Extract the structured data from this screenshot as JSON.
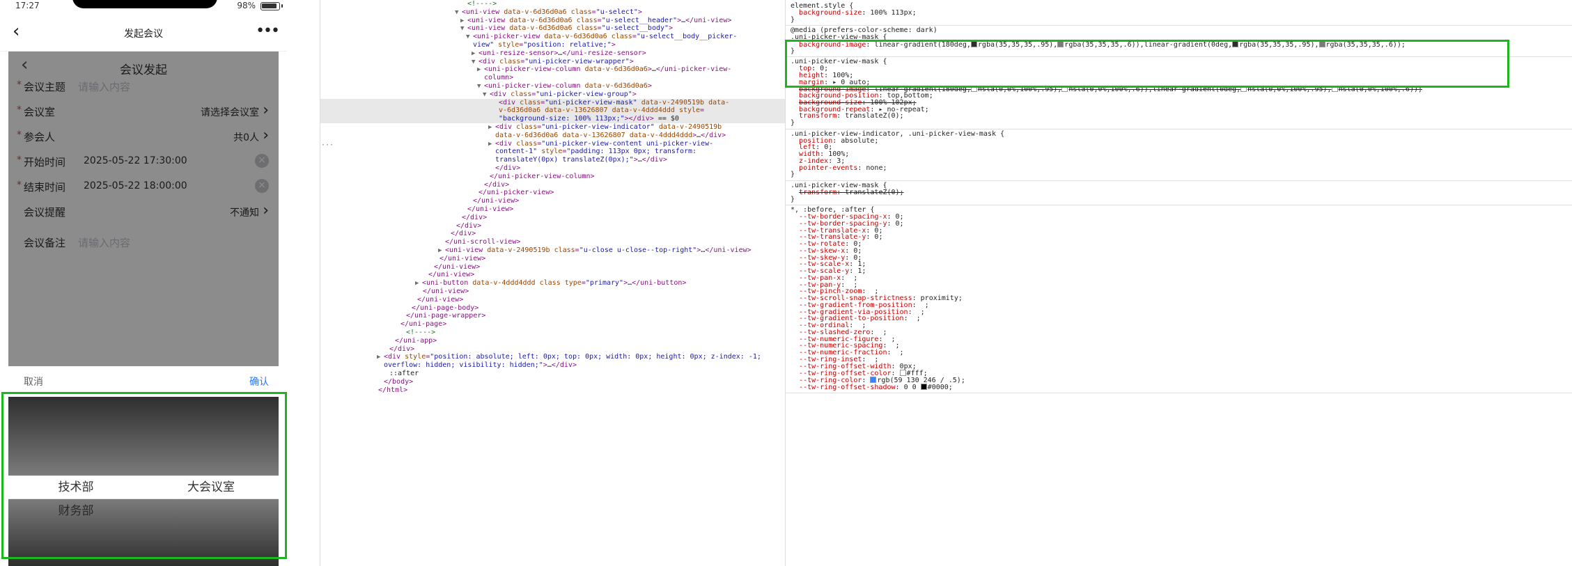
{
  "phone": {
    "status": {
      "time": "17:27",
      "battery": "98%"
    },
    "nav": {
      "back_icon": "chevron-left-icon",
      "title": "发起会议",
      "more_icon": "more-dots-icon",
      "back_glyph": "‹",
      "more_glyph": "•••"
    },
    "page": {
      "back_glyph": "‹",
      "title": "会议发起",
      "rows": [
        {
          "label": "会议主题",
          "required": true,
          "placeholder": "请输入内容"
        },
        {
          "label": "会议室",
          "required": true,
          "right_value": "请选择会议室",
          "arrow": "›"
        },
        {
          "label": "参会人",
          "required": true,
          "right_value": "共0人",
          "arrow": "›"
        },
        {
          "label": "开始时间",
          "required": true,
          "value": "2025-05-22 17:30:00",
          "clear": "×"
        },
        {
          "label": "结束时间",
          "required": true,
          "value": "2025-05-22 18:00:00",
          "clear": "×"
        },
        {
          "label": "会议提醒",
          "required": false,
          "right_value": "不通知",
          "arrow": "›"
        },
        {
          "label": "会议备注",
          "required": false,
          "placeholder": "请输入内容"
        }
      ],
      "required_mark": "*"
    },
    "picker": {
      "cancel": "取消",
      "confirm": "确认",
      "columns": [
        {
          "items": [
            "技术部",
            "财务部"
          ],
          "selected_index": 0
        },
        {
          "items": [
            "大会议室"
          ],
          "selected_index": 0
        }
      ]
    }
  },
  "elements": {
    "lines": [
      {
        "indent": 130,
        "html": "<span class='cmt'>&lt;!----&gt;</span>"
      },
      {
        "indent": 114,
        "tw": "▼",
        "html": "<span class='tag'>&lt;uni-view</span> <span class='attr'>data-v-6d36d0a6</span> <span class='attr'>class</span>=<span class='val'>\"u-select\"</span><span class='tag'>&gt;</span>"
      },
      {
        "indent": 130,
        "tw": "▶",
        "html": "<span class='tag'>&lt;uni-view</span> <span class='attr'>data-v-6d36d0a6</span> <span class='attr'>class</span>=<span class='val'>\"u-select__header\"</span><span class='tag'>&gt;</span><span class='txt'>…</span><span class='tag'>&lt;/uni-view&gt;</span>"
      },
      {
        "indent": 130,
        "tw": "▼",
        "html": "<span class='tag'>&lt;uni-view</span> <span class='attr'>data-v-6d36d0a6</span> <span class='attr'>class</span>=<span class='val'>\"u-select__body\"</span><span class='tag'>&gt;</span>"
      },
      {
        "indent": 146,
        "tw": "▼",
        "html": "<span class='tag'>&lt;uni-picker-view</span> <span class='attr'>data-v-6d36d0a6</span> <span class='attr'>class</span>=<span class='val'>\"u-select__body__picker-</span>"
      },
      {
        "indent": 146,
        "html": "<span class='val'>view\"</span> <span class='attr'>style</span>=<span class='val'>\"position: relative;\"</span><span class='tag'>&gt;</span>"
      },
      {
        "indent": 162,
        "tw": "▶",
        "html": "<span class='tag'>&lt;uni-resize-sensor&gt;</span><span class='txt'>…</span><span class='tag'>&lt;/uni-resize-sensor&gt;</span>"
      },
      {
        "indent": 162,
        "tw": "▼",
        "html": "<span class='tag'>&lt;div</span> <span class='attr'>class</span>=<span class='val'>\"uni-picker-view-wrapper\"</span><span class='tag'>&gt;</span>"
      },
      {
        "indent": 178,
        "tw": "▶",
        "html": "<span class='tag'>&lt;uni-picker-view-column</span> <span class='attr'>data-v-6d36d0a6</span><span class='tag'>&gt;</span><span class='txt'>…</span><span class='tag'>&lt;/uni-picker-view-</span>"
      },
      {
        "indent": 178,
        "html": "<span class='tag'>column&gt;</span>"
      },
      {
        "indent": 178,
        "tw": "▼",
        "html": "<span class='tag'>&lt;uni-picker-view-column</span> <span class='attr'>data-v-6d36d0a6</span><span class='tag'>&gt;</span>"
      },
      {
        "indent": 194,
        "tw": "▼",
        "html": "<span class='tag'>&lt;div</span> <span class='attr'>class</span>=<span class='val'>\"uni-picker-view-group\"</span><span class='tag'>&gt;</span>"
      },
      {
        "indent": 220,
        "selected": true,
        "html": "<span class='tag'>&lt;div</span> <span class='attr'>class</span>=<span class='val'>\"uni-picker-view-mask\"</span> <span class='attr'>data-v-2490519b</span> <span class='attr'>data-</span>"
      },
      {
        "indent": 220,
        "selected": true,
        "html": "<span class='attr'>v-6d36d0a6</span> <span class='attr'>data-v-13626807</span> <span class='attr'>data-v-4ddd4ddd</span> <span class='attr'>style</span>="
      },
      {
        "indent": 220,
        "selected": true,
        "html": "<span class='val'>\"background-size: 100% 113px;\"</span><span class='tag'>&gt;&lt;/div&gt;</span> <span class='txt'>== $0</span>"
      },
      {
        "indent": 210,
        "tw": "▶",
        "html": "<span class='tag'>&lt;div</span> <span class='attr'>class</span>=<span class='val'>\"uni-picker-view-indicator\"</span> <span class='attr'>data-v-2490519b</span>"
      },
      {
        "indent": 210,
        "html": "<span class='attr'>data-v-6d36d0a6</span> <span class='attr'>data-v-13626807</span> <span class='attr'>data-v-4ddd4ddd</span><span class='tag'>&gt;</span><span class='txt'>…</span><span class='tag'>&lt;/div&gt;</span>"
      },
      {
        "indent": 210,
        "tw": "▶",
        "html": "<span class='tag'>&lt;div</span> <span class='attr'>class</span>=<span class='val'>\"uni-picker-view-content uni-picker-view-</span>"
      },
      {
        "indent": 210,
        "html": "<span class='val'>content-1\"</span> <span class='attr'>style</span>=<span class='val'>\"padding: 113px 0px; transform:</span>"
      },
      {
        "indent": 210,
        "html": "<span class='val'>translateY(0px) translateZ(0px);\"</span><span class='tag'>&gt;</span><span class='txt'>…</span><span class='tag'>&lt;/div&gt;</span>"
      },
      {
        "indent": 210,
        "html": "<span class='tag'>&lt;/div&gt;</span>"
      },
      {
        "indent": 194,
        "html": "<span class='tag'>&lt;/uni-picker-view-column&gt;</span>"
      },
      {
        "indent": 178,
        "html": "<span class='tag'>&lt;/div&gt;</span>"
      },
      {
        "indent": 162,
        "html": "<span class='tag'>&lt;/uni-picker-view&gt;</span>"
      },
      {
        "indent": 146,
        "html": "<span class='tag'>&lt;/uni-view&gt;</span>"
      },
      {
        "indent": 130,
        "html": "<span class='tag'>&lt;/uni-view&gt;</span>"
      },
      {
        "indent": 114,
        "html": "<span class='tag'>&lt;/div&gt;</span>"
      },
      {
        "indent": 98,
        "html": "<span class='tag'>&lt;/div&gt;</span>"
      },
      {
        "indent": 82,
        "html": "<span class='tag'>&lt;/div&gt;</span>"
      },
      {
        "indent": 66,
        "html": "<span class='tag'>&lt;/uni-scroll-view&gt;</span>"
      },
      {
        "indent": 66,
        "tw": "▶",
        "html": "<span class='tag'>&lt;uni-view</span> <span class='attr'>data-v-2490519b</span> <span class='attr'>class</span>=<span class='val'>\"u-close u-close--top-right\"</span><span class='tag'>&gt;</span><span class='txt'>…</span><span class='tag'>&lt;/uni-view&gt;</span>"
      },
      {
        "indent": 50,
        "html": "<span class='tag'>&lt;/uni-view&gt;</span>"
      },
      {
        "indent": 34,
        "html": "<span class='tag'>&lt;/uni-view&gt;</span>"
      },
      {
        "indent": 18,
        "html": "<span class='tag'>&lt;/uni-view&gt;</span>"
      },
      {
        "indent": 0,
        "tw": "▶",
        "html": "<span class='tag'>&lt;uni-button</span> <span class='attr'>data-v-4ddd4ddd</span> <span class='attr'>class</span> <span class='attr'>type</span>=<span class='val'>\"primary\"</span><span class='tag'>&gt;</span><span class='txt'>…</span><span class='tag'>&lt;/uni-button&gt;</span>"
      },
      {
        "indent": 2,
        "html": "<span class='tag'>&lt;/uni-view&gt;</span>"
      },
      {
        "indent": -14,
        "html": "<span class='tag'>&lt;/uni-view&gt;</span>"
      },
      {
        "indent": -30,
        "html": "<span class='tag'>&lt;/uni-page-body&gt;</span>"
      },
      {
        "indent": -46,
        "html": "<span class='tag'>&lt;/uni-page-wrapper&gt;</span>"
      },
      {
        "indent": -62,
        "html": "<span class='tag'>&lt;/uni-page&gt;</span>"
      },
      {
        "indent": -46,
        "html": "<span class='cmt'>&lt;!----&gt;</span>"
      },
      {
        "indent": -78,
        "html": "<span class='tag'>&lt;/uni-app&gt;</span>"
      },
      {
        "indent": -94,
        "html": "<span class='tag'>&lt;/div&gt;</span>"
      },
      {
        "indent": -110,
        "tw": "▶",
        "html": "<span class='tag'>&lt;div</span> <span class='attr'>style</span>=<span class='val'>\"position: absolute; left: 0px; top: 0px; width: 0px; height: 0px; z-index: -1;</span>"
      },
      {
        "indent": -110,
        "html": "<span class='val'>overflow: hidden; visibility: hidden;\"</span><span class='tag'>&gt;</span><span class='txt'>…</span><span class='tag'>&lt;/div&gt;</span>"
      },
      {
        "indent": -94,
        "html": "<span class='txt'>::after</span>"
      },
      {
        "indent": -110,
        "html": "<span class='tag'>&lt;/body&gt;</span>"
      },
      {
        "indent": -126,
        "html": "<span class='tag'>&lt;/html&gt;</span>"
      }
    ],
    "ellipsis": "···"
  },
  "styles": {
    "rules": [
      {
        "lines": [
          "<span class='sel-text'>element.style {</span>",
          "  <span class='prop'>background-size</span>: <span class='pval'>100% 113px;</span>",
          "<span class='sel-text'>}</span>"
        ]
      },
      {
        "lines": [
          "<span class='media'>@media (prefers-color-scheme: dark)</span>",
          "<span class='sel-text'>.uni-picker-view-mask {</span>",
          "  <span class='prop'>background-image</span>: <span class='pval'>linear-gradient(180deg,<span class='swatch' style='background:rgba(35,35,35,.95)'></span>rgba(35,35,35,.95),<span class='swatch' style='background:rgba(35,35,35,.6)'></span>rgba(35,35,35,.6)),linear-gradient(0deg,<span class='swatch' style='background:rgba(35,35,35,.95)'></span>rgba(35,35,35,.95),<span class='swatch' style='background:rgba(35,35,35,.6)'></span>rgba(35,35,35,.6));</span>",
          "<span class='sel-text'>}</span>"
        ]
      },
      {
        "lines": [
          "<span class='sel-text'>.uni-picker-view-mask {</span>",
          "  <span class='prop'>top</span>: <span class='pval'>0;</span>",
          "  <span class='prop'>height</span>: <span class='pval'>100%;</span>",
          "  <span class='prop'>margin</span>: <span class='pval'>▸ 0 auto;</span>",
          "  <span class='struck'><span class='prop'>background-image</span>: <span class='pval'>linear-gradient(180deg,<span class='swatch' style='background:#fff'></span>hsla(0,0%,100%,.95),<span class='swatch' style='background:#fff'></span>hsla(0,0%,100%,.6)),linear-gradient(0deg,<span class='swatch' style='background:#fff'></span>hsla(0,0%,100%,.95),<span class='swatch' style='background:#fff'></span>hsla(0,0%,100%,.6));</span></span>",
          "  <span class='prop'>background-position</span>: <span class='pval'>top,bottom;</span>",
          "  <span class='struck'><span class='prop'>background-size</span>: <span class='pval'>100% 102px;</span></span>",
          "  <span class='prop'>background-repeat</span>: <span class='pval'>▸ no-repeat;</span>",
          "  <span class='prop'>transform</span>: <span class='pval'>translateZ(0);</span>",
          "<span class='sel-text'>}</span>"
        ]
      },
      {
        "lines": [
          "<span class='sel-text'>.uni-picker-view-indicator, .uni-picker-view-mask {</span>",
          "  <span class='prop'>position</span>: <span class='pval'>absolute;</span>",
          "  <span class='prop'>left</span>: <span class='pval'>0;</span>",
          "  <span class='prop'>width</span>: <span class='pval'>100%;</span>",
          "  <span class='prop'>z-index</span>: <span class='pval'>3;</span>",
          "  <span class='prop'>pointer-events</span>: <span class='pval'>none;</span>",
          "<span class='sel-text'>}</span>"
        ]
      },
      {
        "lines": [
          "<span class='sel-text'>.uni-picker-view-mask {</span>",
          "  <span class='struck'><span class='prop'>transform</span>: <span class='pval'>translateZ(0);</span></span>",
          "<span class='sel-text'>}</span>"
        ]
      },
      {
        "lines": [
          "<span class='sel-text'>*, :before, :after {</span>",
          "  <span class='prop'>--tw-border-spacing-x</span>: <span class='pval'>0;</span>",
          "  <span class='prop'>--tw-border-spacing-y</span>: <span class='pval'>0;</span>",
          "  <span class='prop'>--tw-translate-x</span>: <span class='pval'>0;</span>",
          "  <span class='prop'>--tw-translate-y</span>: <span class='pval'>0;</span>",
          "  <span class='prop'>--tw-rotate</span>: <span class='pval'>0;</span>",
          "  <span class='prop'>--tw-skew-x</span>: <span class='pval'>0;</span>",
          "  <span class='prop'>--tw-skew-y</span>: <span class='pval'>0;</span>",
          "  <span class='prop'>--tw-scale-x</span>: <span class='pval'>1;</span>",
          "  <span class='prop'>--tw-scale-y</span>: <span class='pval'>1;</span>",
          "  <span class='prop'>--tw-pan-x</span>: <span class='pval'> ;</span>",
          "  <span class='prop'>--tw-pan-y</span>: <span class='pval'> ;</span>",
          "  <span class='prop'>--tw-pinch-zoom</span>: <span class='pval'> ;</span>",
          "  <span class='prop'>--tw-scroll-snap-strictness</span>: <span class='pval'>proximity;</span>",
          "  <span class='prop'>--tw-gradient-from-position</span>: <span class='pval'> ;</span>",
          "  <span class='prop'>--tw-gradient-via-position</span>: <span class='pval'> ;</span>",
          "  <span class='prop'>--tw-gradient-to-position</span>: <span class='pval'> ;</span>",
          "  <span class='prop'>--tw-ordinal</span>: <span class='pval'> ;</span>",
          "  <span class='prop'>--tw-slashed-zero</span>: <span class='pval'> ;</span>",
          "  <span class='prop'>--tw-numeric-figure</span>: <span class='pval'> ;</span>",
          "  <span class='prop'>--tw-numeric-spacing</span>: <span class='pval'> ;</span>",
          "  <span class='prop'>--tw-numeric-fraction</span>: <span class='pval'> ;</span>",
          "  <span class='prop'>--tw-ring-inset</span>: <span class='pval'> ;</span>",
          "  <span class='prop'>--tw-ring-offset-width</span>: <span class='pval'>0px;</span>",
          "  <span class='prop'>--tw-ring-offset-color</span>: <span class='pval'><span class='swatch' style='background:#fff'></span>#fff;</span>",
          "  <span class='prop'>--tw-ring-color</span>: <span class='pval'><span class='swatch' style='background:rgb(59,130,246)'></span>rgb(59 130 246 / .5);</span>",
          "  <span class='prop'>--tw-ring-offset-shadow</span>: <span class='pval'>0 0 <span class='swatch' style='background:#000'></span>#0000;</span>"
        ]
      }
    ]
  },
  "colors": {
    "highlight": "#1fb51f",
    "required": "#e64340",
    "confirm": "#2979ff",
    "mask": "rgba(35,35,35,.95)"
  }
}
